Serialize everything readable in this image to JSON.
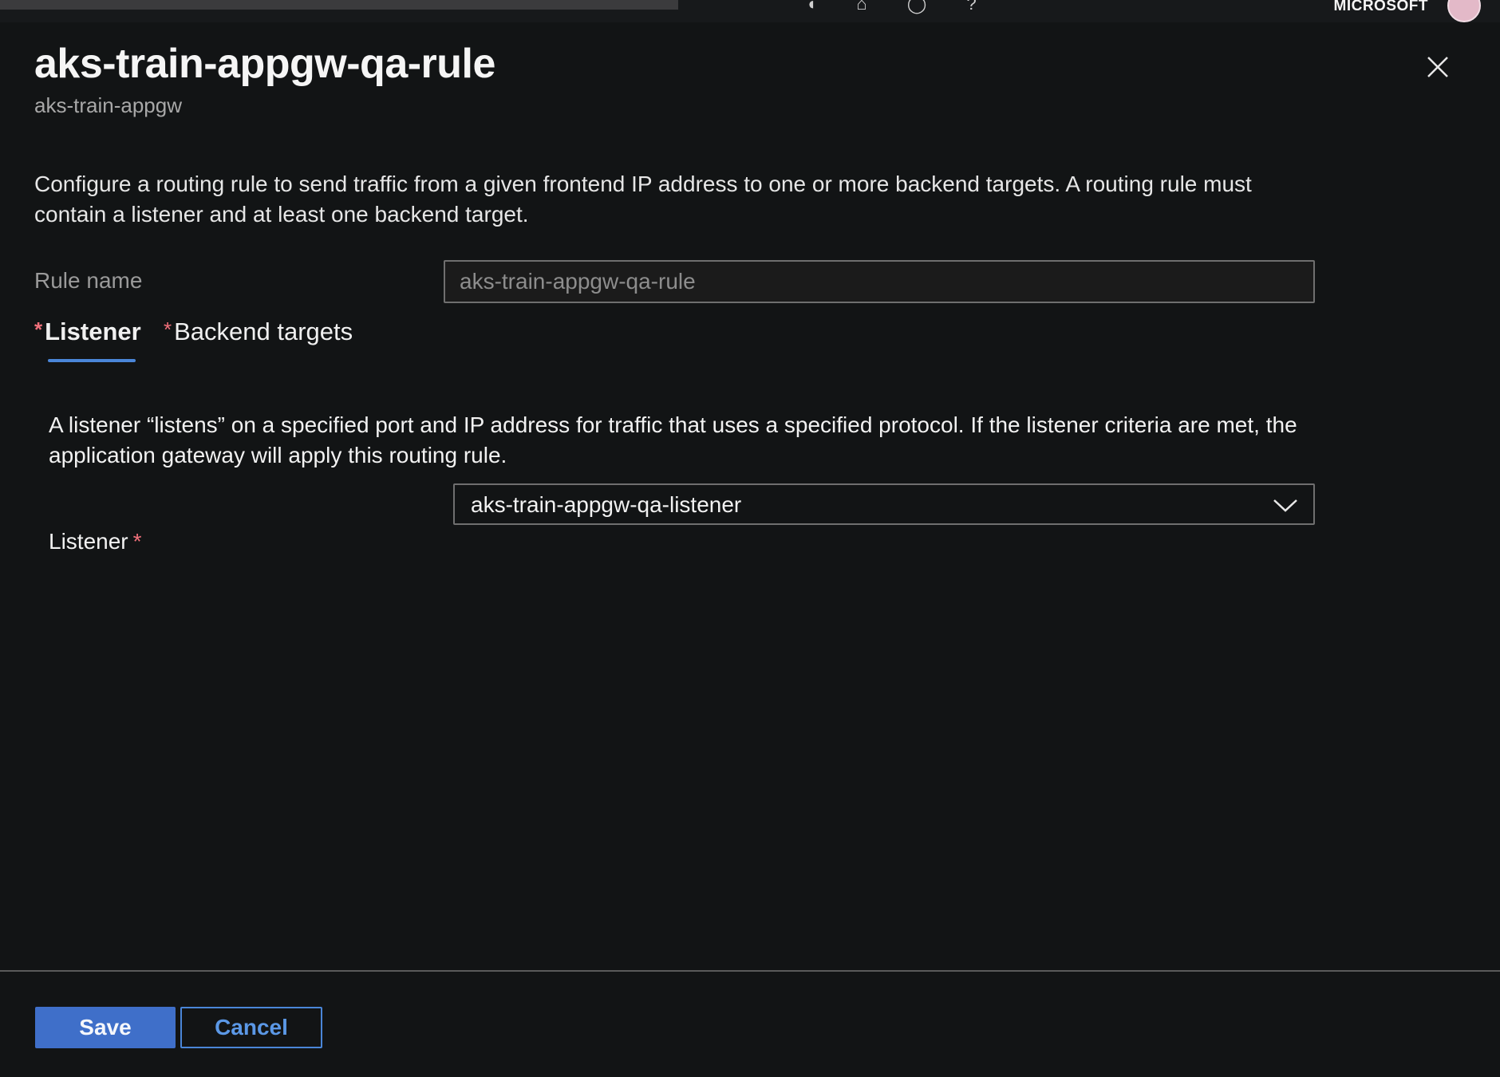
{
  "topbar": {
    "tenant": "MICROSOFT",
    "glyphs": "◖ ⌂ ◯ ?"
  },
  "panel": {
    "title": "aks-train-appgw-qa-rule",
    "subtitle": "aks-train-appgw",
    "description": "Configure a routing rule to send traffic from a given frontend IP address to one or more backend targets. A routing rule must contain a listener and at least one backend target.",
    "rule_name_label": "Rule name",
    "rule_name_value": "aks-train-appgw-qa-rule"
  },
  "tabs": {
    "listener": {
      "star": "*",
      "label": "Listener"
    },
    "backend": {
      "star": "*",
      "label": "Backend targets"
    }
  },
  "listener_tab": {
    "description": "A listener “listens” on a specified port and IP address for traffic that uses a specified protocol. If the listener criteria are met, the application gateway will apply this routing rule.",
    "label": "Listener",
    "required_mark": "*",
    "selected": "aks-train-appgw-qa-listener"
  },
  "footer": {
    "save_label": "Save",
    "cancel_label": "Cancel"
  },
  "colors": {
    "accent": "#4a86d8",
    "primary_button": "#3f6fc9",
    "required": "#f1707b",
    "background": "#121415"
  },
  "icons": {
    "close": "close-icon",
    "dropdown": "chevron-down-icon"
  }
}
